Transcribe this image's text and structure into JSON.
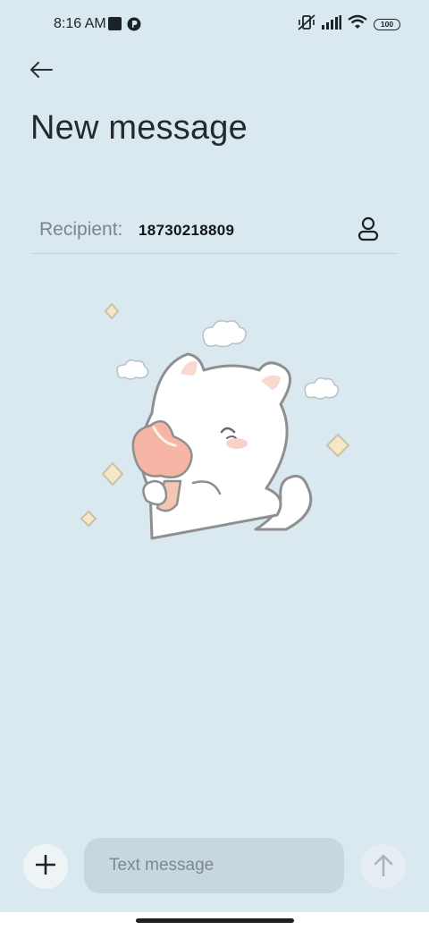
{
  "status_bar": {
    "time": "8:16 AM",
    "icons": [
      "square-app-icon",
      "circle-app-icon",
      "vibrate-off-icon",
      "signal-icon",
      "wifi-icon"
    ],
    "battery_level": "100"
  },
  "header": {
    "back_icon": "back-arrow-icon",
    "title": "New message"
  },
  "recipient": {
    "label": "Recipient:",
    "value": "18730218809",
    "contact_icon": "contact-person-icon"
  },
  "illustration": {
    "subject": "cat-eating-ice-cream-sticker"
  },
  "composer": {
    "attach_icon": "plus-icon",
    "placeholder": "Text message",
    "value": "",
    "send_icon": "send-arrow-up-icon"
  },
  "colors": {
    "background": "#dae8f0",
    "input_background": "#c7d6df",
    "text_primary": "#23292d",
    "text_secondary": "#7a858c"
  }
}
